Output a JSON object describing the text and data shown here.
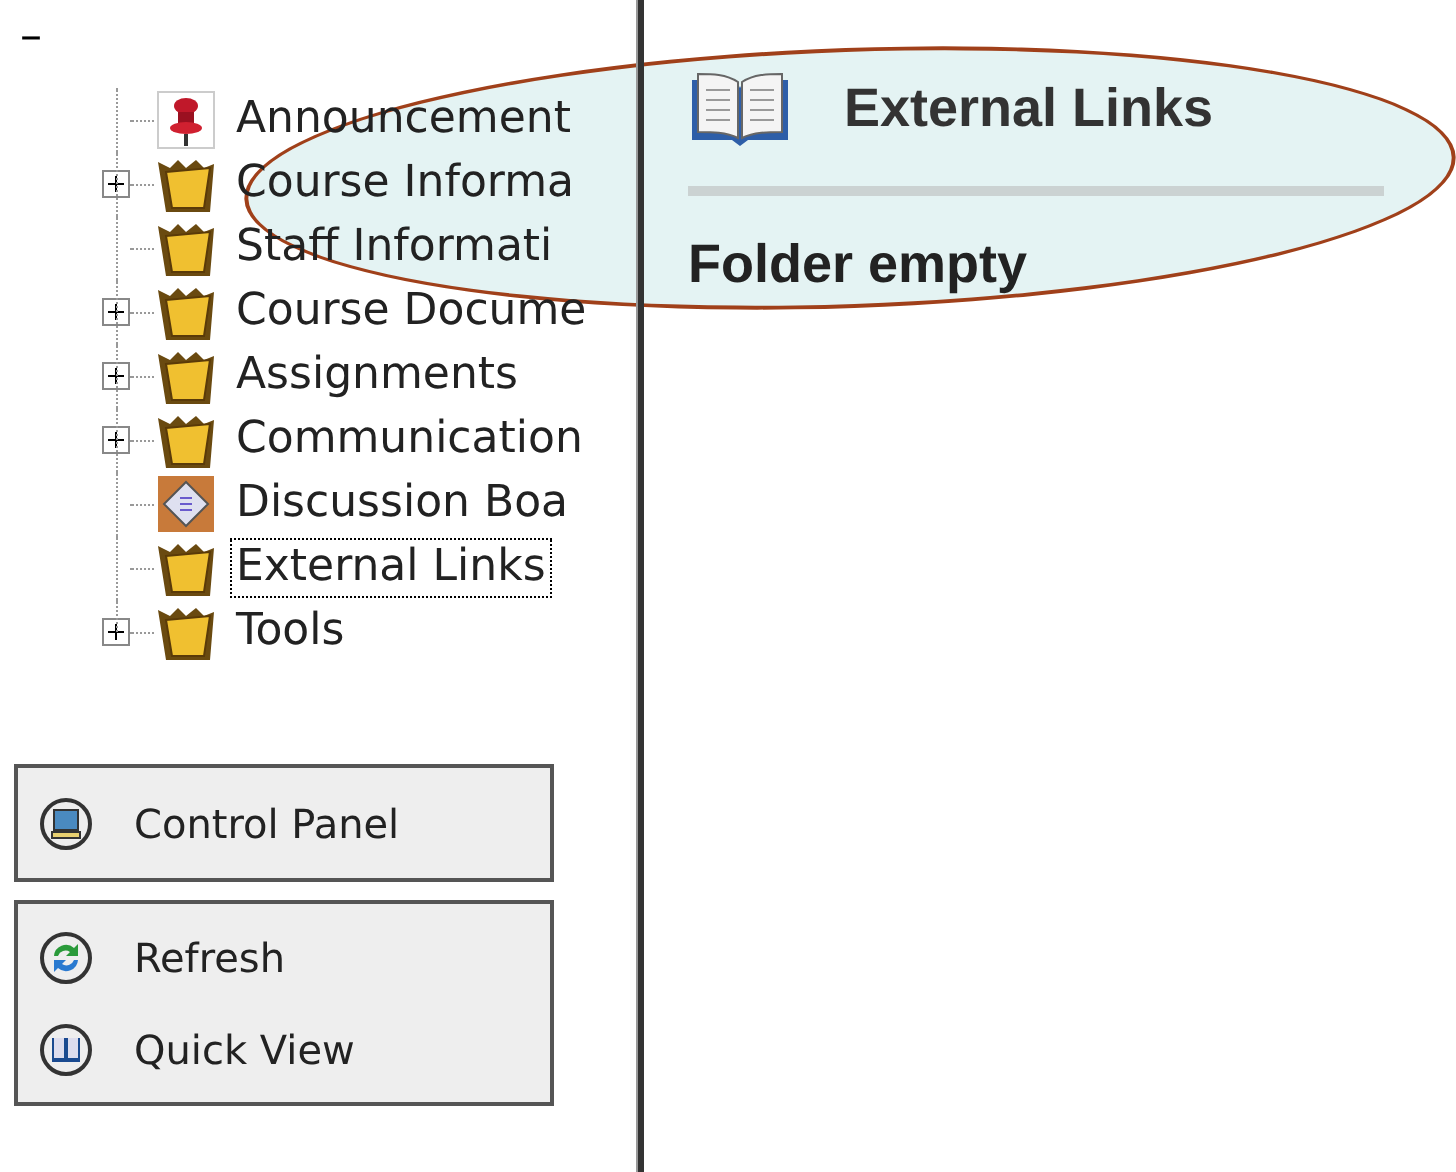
{
  "collapse_mark": "–",
  "tree": [
    {
      "label": "Announcement",
      "kind": "pin",
      "expandable": false,
      "selected": false
    },
    {
      "label": "Course Informa",
      "kind": "folder",
      "expandable": true,
      "selected": false
    },
    {
      "label": "Staff Informati",
      "kind": "folder",
      "expandable": false,
      "selected": false
    },
    {
      "label": "Course Docume",
      "kind": "folder",
      "expandable": true,
      "selected": false
    },
    {
      "label": "Assignments",
      "kind": "folder",
      "expandable": true,
      "selected": false
    },
    {
      "label": "Communication",
      "kind": "folder",
      "expandable": true,
      "selected": false
    },
    {
      "label": "Discussion Boa",
      "kind": "board",
      "expandable": false,
      "selected": false
    },
    {
      "label": "External Links",
      "kind": "folder",
      "expandable": false,
      "selected": true
    },
    {
      "label": "Tools",
      "kind": "folder",
      "expandable": true,
      "selected": false
    }
  ],
  "control_box": [
    {
      "label": "Control Panel",
      "kind": "monitor"
    }
  ],
  "tools_box": [
    {
      "label": "Refresh",
      "kind": "refresh"
    },
    {
      "label": "Quick View",
      "kind": "book"
    }
  ],
  "panel": {
    "title": "External Links",
    "message": "Folder empty"
  }
}
